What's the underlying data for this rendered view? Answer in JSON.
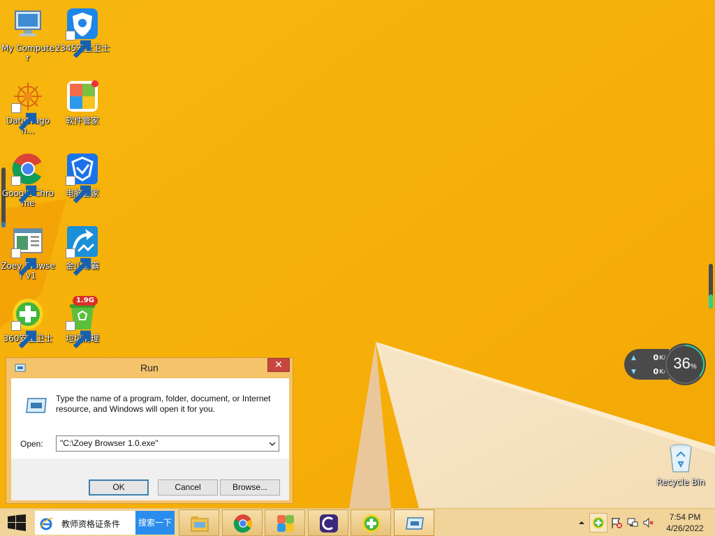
{
  "desktop": {
    "icons": [
      {
        "label": "My Computer",
        "icon": "computer-icon"
      },
      {
        "label": "2345安全卫士",
        "icon": "shield-icon"
      },
      {
        "label": "DataWagon...",
        "icon": "datawagon-icon"
      },
      {
        "label": "软件管家",
        "icon": "software-manager-icon"
      },
      {
        "label": "Google Chrome",
        "icon": "chrome-icon"
      },
      {
        "label": "电脑管家",
        "icon": "pc-manager-icon"
      },
      {
        "label": "Zoey Browser v1",
        "icon": "zoey-browser-icon"
      },
      {
        "label": "金山毒霸",
        "icon": "kingsoft-antivirus-icon"
      },
      {
        "label": "360安全卫士",
        "icon": "360-security-icon"
      },
      {
        "label": "垃圾清理",
        "icon": "trash-cleanup-icon"
      },
      {
        "label": "Recycle Bin",
        "icon": "recycle-bin-icon"
      }
    ],
    "cleanup_badge": "1.9G"
  },
  "net_widget": {
    "upload": "0",
    "upload_unit": "K/s",
    "download": "0",
    "download_unit": "K/s",
    "cpu_percent": "36",
    "cpu_unit": "%"
  },
  "run_dialog": {
    "title": "Run",
    "close_label": "✕",
    "description": "Type the name of a program, folder, document, or Internet resource, and Windows will open it for you.",
    "open_label": "Open:",
    "open_value": "\"C:\\Zoey Browser 1.0.exe\"",
    "ok_label": "OK",
    "cancel_label": "Cancel",
    "browse_label": "Browse..."
  },
  "taskbar": {
    "search_text": "教师资格证条件",
    "search_button": "搜索一下",
    "apps": [
      "file-explorer-icon",
      "chrome-icon",
      "app-store-icon",
      "c-browser-icon",
      "360-security-icon",
      "run-icon"
    ],
    "clock_time": "7:54 PM",
    "clock_date": "4/26/2022"
  },
  "colors": {
    "wallpaper": "#f5b00a",
    "dialog_frame": "#f4c36a",
    "close_red": "#c7463e",
    "taskbar": "#f0d49a",
    "search_blue": "#2a8cec"
  }
}
